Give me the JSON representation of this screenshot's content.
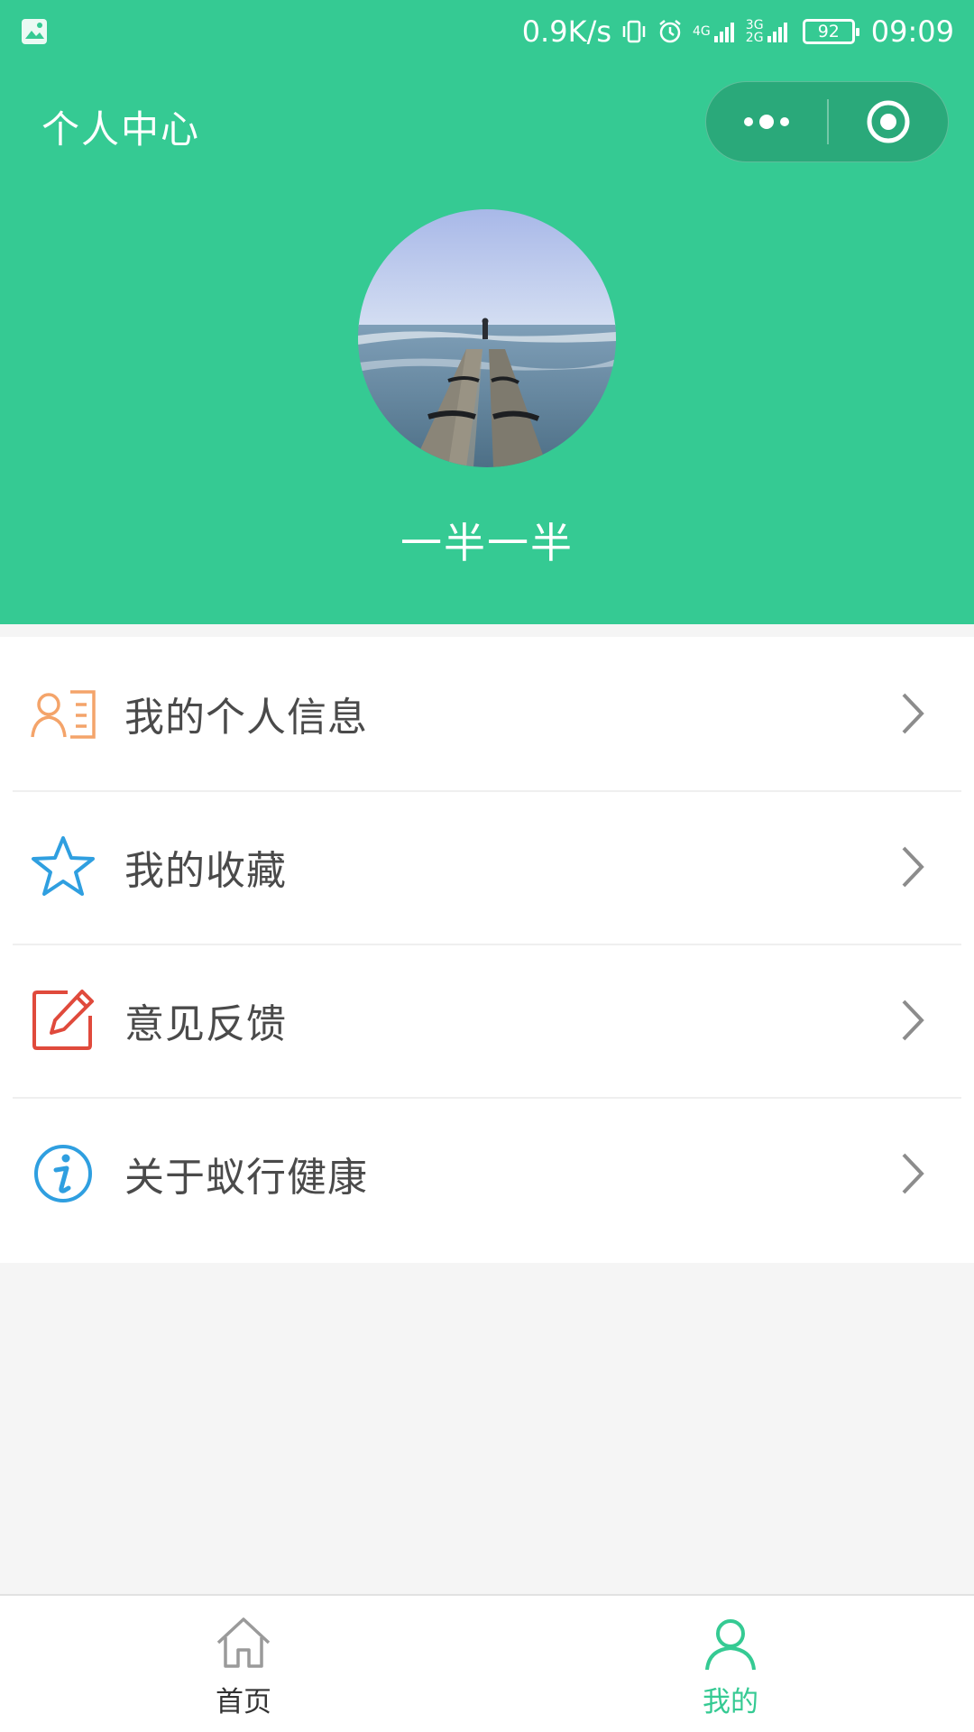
{
  "status_bar": {
    "net_speed": "0.9K/s",
    "signal1": "4G",
    "signal2": "3G 2G",
    "battery": "92",
    "time": "09:09"
  },
  "header": {
    "title": "个人中心",
    "username": "一半一半"
  },
  "menu": {
    "items": [
      {
        "label": "我的个人信息",
        "icon": "profile-card-icon",
        "color": "#f4a46a"
      },
      {
        "label": "我的收藏",
        "icon": "star-icon",
        "color": "#2f9fe0"
      },
      {
        "label": "意见反馈",
        "icon": "edit-icon",
        "color": "#e04a3c"
      },
      {
        "label": "关于蚁行健康",
        "icon": "info-icon",
        "color": "#2f9fe0"
      }
    ]
  },
  "tabbar": {
    "tabs": [
      {
        "label": "首页",
        "icon": "home-icon",
        "active": false
      },
      {
        "label": "我的",
        "icon": "user-icon",
        "active": true
      }
    ]
  },
  "colors": {
    "brand": "#35ca93",
    "text": "#4a4a4a",
    "background": "#f5f5f5"
  }
}
